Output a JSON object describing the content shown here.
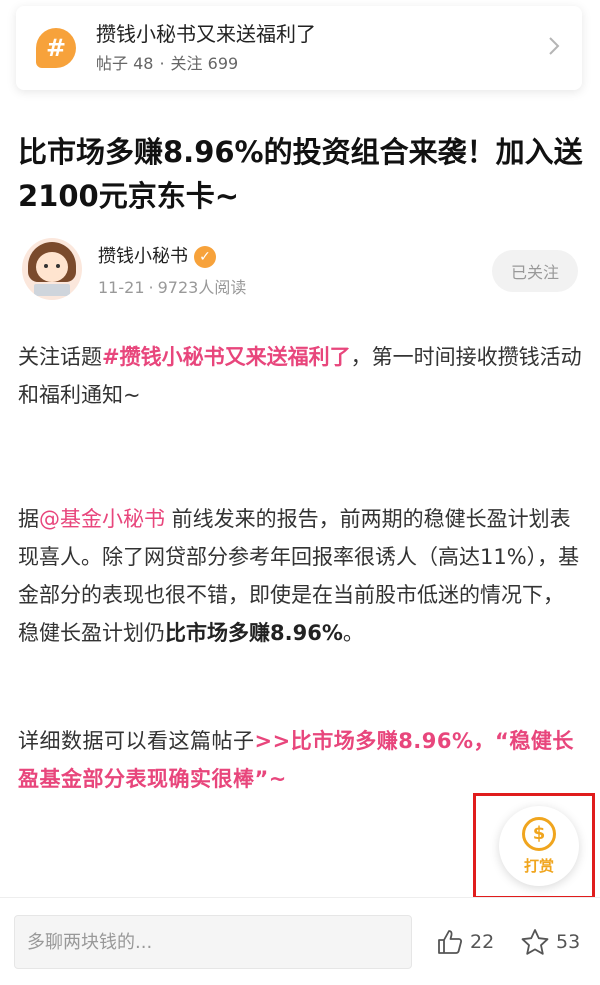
{
  "topic": {
    "title": "攒钱小秘书又来送福利了",
    "posts_label": "帖子 48",
    "separator": "·",
    "follows_label": "关注 699",
    "icon": "hash-icon"
  },
  "article": {
    "title": "比市场多赚8.96%的投资组合来袭！加入送2100元京东卡~"
  },
  "author": {
    "name": "攒钱小秘书",
    "date": "11-21",
    "separator": "·",
    "reads": "9723人阅读",
    "follow_state": "已关注"
  },
  "body": {
    "p1_prefix": "关注话题",
    "p1_link": "#攒钱小秘书又来送福利了",
    "p1_suffix": "，第一时间接收攒钱活动和福利通知~",
    "p2_prefix": "据",
    "p2_mention": "@基金小秘书",
    "p2_text": " 前线发来的报告，前两期的稳健长盈计划表现喜人。除了网贷部分参考年回报率很诱人（高达11%），基金部分的表现也很不错，即使是在当前股市低迷的情况下，稳健长盈计划仍",
    "p2_bold": "比市场多赚8.96%",
    "p2_end": "。",
    "p3_prefix": "详细数据可以看这篇帖子",
    "p3_link": ">>比市场多赚8.96%，“稳健长盈基金部分表现确实很棒”~"
  },
  "tip": {
    "label": "打赏",
    "coin_symbol": "$"
  },
  "bottom_bar": {
    "comment_placeholder": "多聊两块钱的...",
    "likes": "22",
    "favorites": "53"
  },
  "colors": {
    "accent_pink": "#e8467c",
    "accent_orange": "#f7a23b",
    "highlight_red": "#e01c1c"
  }
}
